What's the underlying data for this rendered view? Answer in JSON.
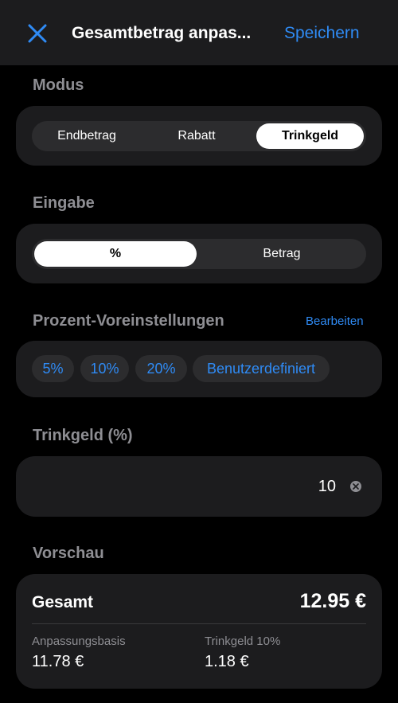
{
  "header": {
    "title": "Gesamtbetrag anpas...",
    "save_label": "Speichern",
    "close_icon": "close-icon"
  },
  "mode": {
    "label": "Modus",
    "options": [
      "Endbetrag",
      "Rabatt",
      "Trinkgeld"
    ],
    "selected": "Trinkgeld"
  },
  "input": {
    "label": "Eingabe",
    "options": [
      "%",
      "Betrag"
    ],
    "selected": "%"
  },
  "presets": {
    "label": "Prozent-Voreinstellungen",
    "edit_label": "Bearbeiten",
    "chips": [
      "5%",
      "10%",
      "20%",
      "Benutzerdefiniert"
    ]
  },
  "tip": {
    "label": "Trinkgeld (%)",
    "value": "10"
  },
  "preview": {
    "label": "Vorschau",
    "total_label": "Gesamt",
    "total_value": "12.95 €",
    "base_label": "Anpassungsbasis",
    "base_value": "11.78 €",
    "tip_label": "Trinkgeld 10%",
    "tip_value": "1.18 €"
  },
  "colors": {
    "accent": "#2f8bf5",
    "background": "#000000",
    "card": "#1c1c1e",
    "muted_text": "#8e8e93"
  }
}
